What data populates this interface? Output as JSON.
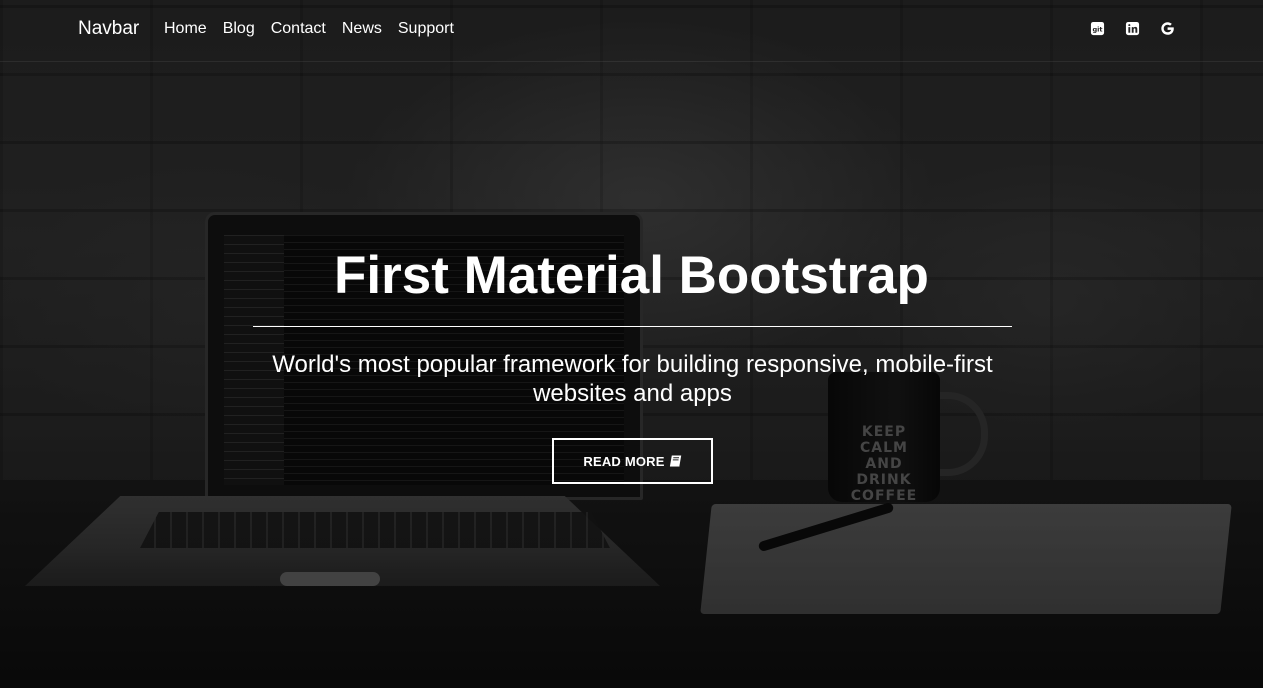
{
  "navbar": {
    "brand": "Navbar",
    "links": [
      {
        "label": "Home"
      },
      {
        "label": "Blog"
      },
      {
        "label": "Contact"
      },
      {
        "label": "News"
      },
      {
        "label": "Support"
      }
    ],
    "icons": [
      {
        "name": "git-icon"
      },
      {
        "name": "linkedin-icon"
      },
      {
        "name": "google-icon"
      }
    ]
  },
  "hero": {
    "title": "First Material Bootstrap",
    "subtitle": "World's most popular framework for building responsive, mobile-first websites and apps",
    "button_label": "READ MORE",
    "button_icon": "book-icon"
  },
  "background": {
    "mug_text": "KEEP CALM AND DRINK COFFEE"
  },
  "colors": {
    "text": "#ffffff",
    "overlay": "#000000"
  }
}
